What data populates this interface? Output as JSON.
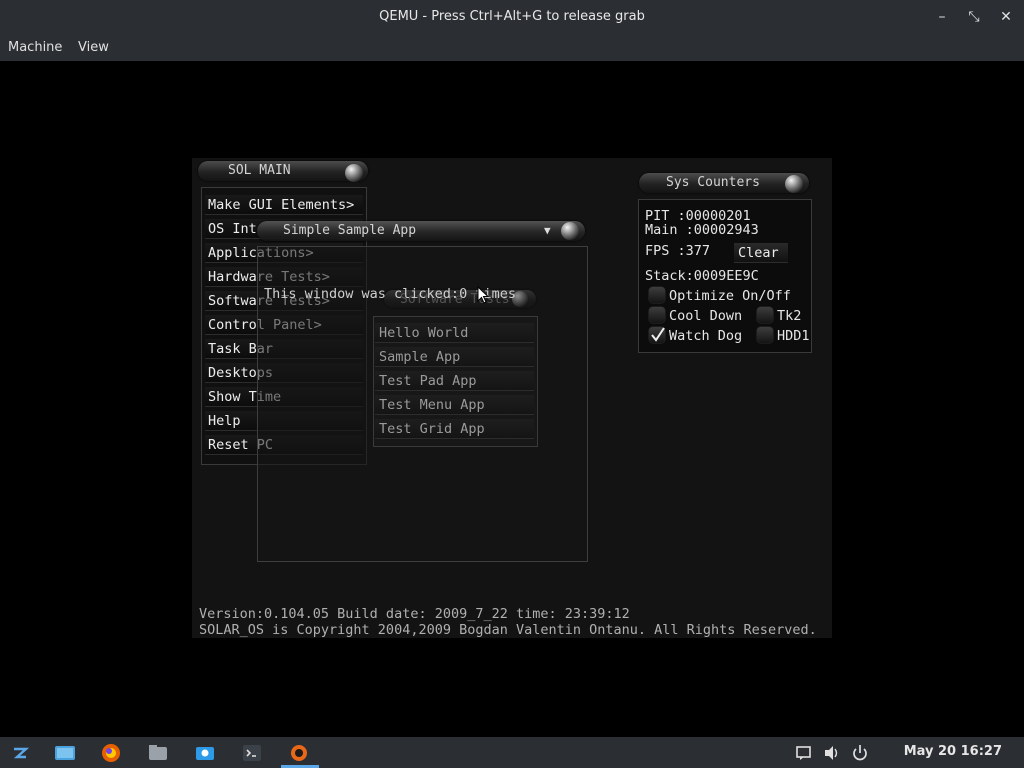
{
  "window": {
    "title": "QEMU - Press Ctrl+Alt+G to release grab",
    "controls": {
      "minimize": "–",
      "maximize": "⤡",
      "close": "✕"
    }
  },
  "menubar": [
    "Machine",
    "View"
  ],
  "solmain": {
    "title": "SOL MAIN",
    "items": [
      "Make GUI Elements>",
      "OS Int",
      "Applications>",
      "Hardware Tests>",
      "Software Tests>",
      "Control Panel>",
      "Task Bar",
      "Desktops",
      "Show Time",
      "Help",
      "Reset PC"
    ]
  },
  "simple_app": {
    "title": "Simple Sample App",
    "message": "This window was clicked:0 times"
  },
  "software_tests": {
    "title": "Software Tests",
    "items": [
      "Hello World",
      "Sample App",
      "Test Pad App",
      "Test Menu App",
      "Test Grid App"
    ]
  },
  "sys_counters": {
    "title": "Sys Counters",
    "pit_label": "PIT  :00000201",
    "main_label": "Main :00002943",
    "fps_label": "FPS  :377",
    "clear_button": "Clear",
    "stack_label": "Stack:0009EE9C",
    "optimize": {
      "label": "Optimize On/Off",
      "checked": false
    },
    "cool_down": {
      "label": "Cool Down",
      "checked": false
    },
    "tk2": {
      "label": "Tk2",
      "checked": false
    },
    "watch_dog": {
      "label": "Watch Dog",
      "checked": true
    },
    "hdd1": {
      "label": "HDD1",
      "checked": false
    }
  },
  "footer": {
    "version": "Version:0.104.05  Build date: 2009_7_22  time: 23:39:12",
    "copyright": "SOLAR_OS is Copyright 2004,2009 Bogdan Valentin Ontanu. All Rights Reserved."
  },
  "taskbar": {
    "icons": [
      "menu-icon",
      "desktop-icon",
      "firefox-icon",
      "files-icon",
      "screenshot-icon",
      "terminal-icon",
      "qemu-icon"
    ],
    "clock": "May 20  16:27"
  }
}
